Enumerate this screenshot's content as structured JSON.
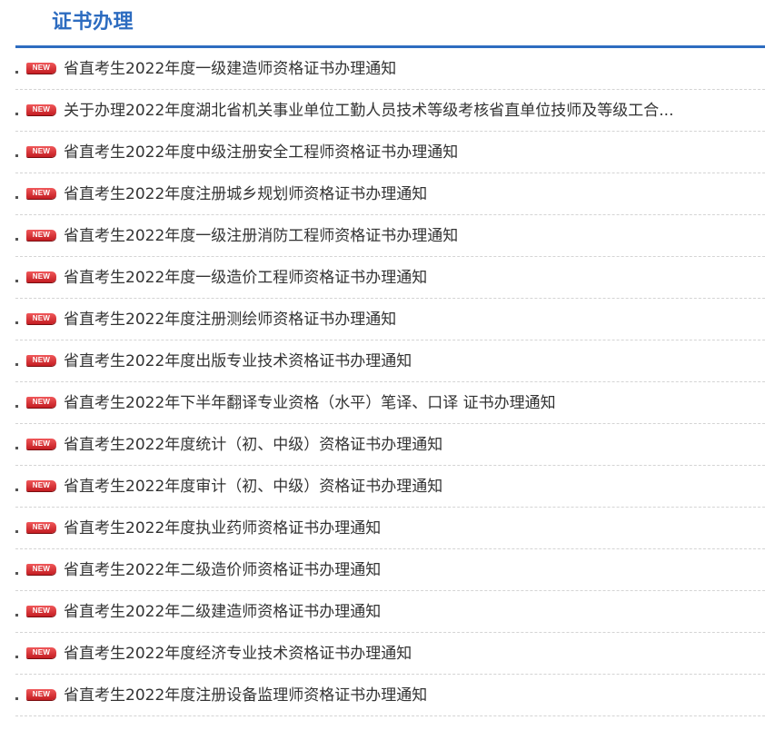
{
  "panel": {
    "title": "证书办理"
  },
  "badge_text": "NEW",
  "items": [
    {
      "title": "省直考生2022年度一级建造师资格证书办理通知"
    },
    {
      "title": "关于办理2022年度湖北省机关事业单位工勤人员技术等级考核省直单位技师及等级工合..."
    },
    {
      "title": "省直考生2022年度中级注册安全工程师资格证书办理通知"
    },
    {
      "title": "省直考生2022年度注册城乡规划师资格证书办理通知"
    },
    {
      "title": "省直考生2022年度一级注册消防工程师资格证书办理通知"
    },
    {
      "title": "省直考生2022年度一级造价工程师资格证书办理通知"
    },
    {
      "title": "省直考生2022年度注册测绘师资格证书办理通知"
    },
    {
      "title": "省直考生2022年度出版专业技术资格证书办理通知"
    },
    {
      "title": "省直考生2022年下半年翻译专业资格（水平）笔译、口译 证书办理通知"
    },
    {
      "title": "省直考生2022年度统计（初、中级）资格证书办理通知"
    },
    {
      "title": "省直考生2022年度审计（初、中级）资格证书办理通知"
    },
    {
      "title": "省直考生2022年度执业药师资格证书办理通知"
    },
    {
      "title": "省直考生2022年二级造价师资格证书办理通知"
    },
    {
      "title": "省直考生2022年二级建造师资格证书办理通知"
    },
    {
      "title": "省直考生2022年度经济专业技术资格证书办理通知"
    },
    {
      "title": "省直考生2022年度注册设备监理师资格证书办理通知"
    }
  ],
  "colors": {
    "accent": "#2d6cc0",
    "badge": "#d8262b",
    "text": "#333333",
    "divider": "#d4d4d4"
  },
  "icons": {
    "bullet": "square-bullet-icon",
    "badge": "new-badge-icon"
  }
}
